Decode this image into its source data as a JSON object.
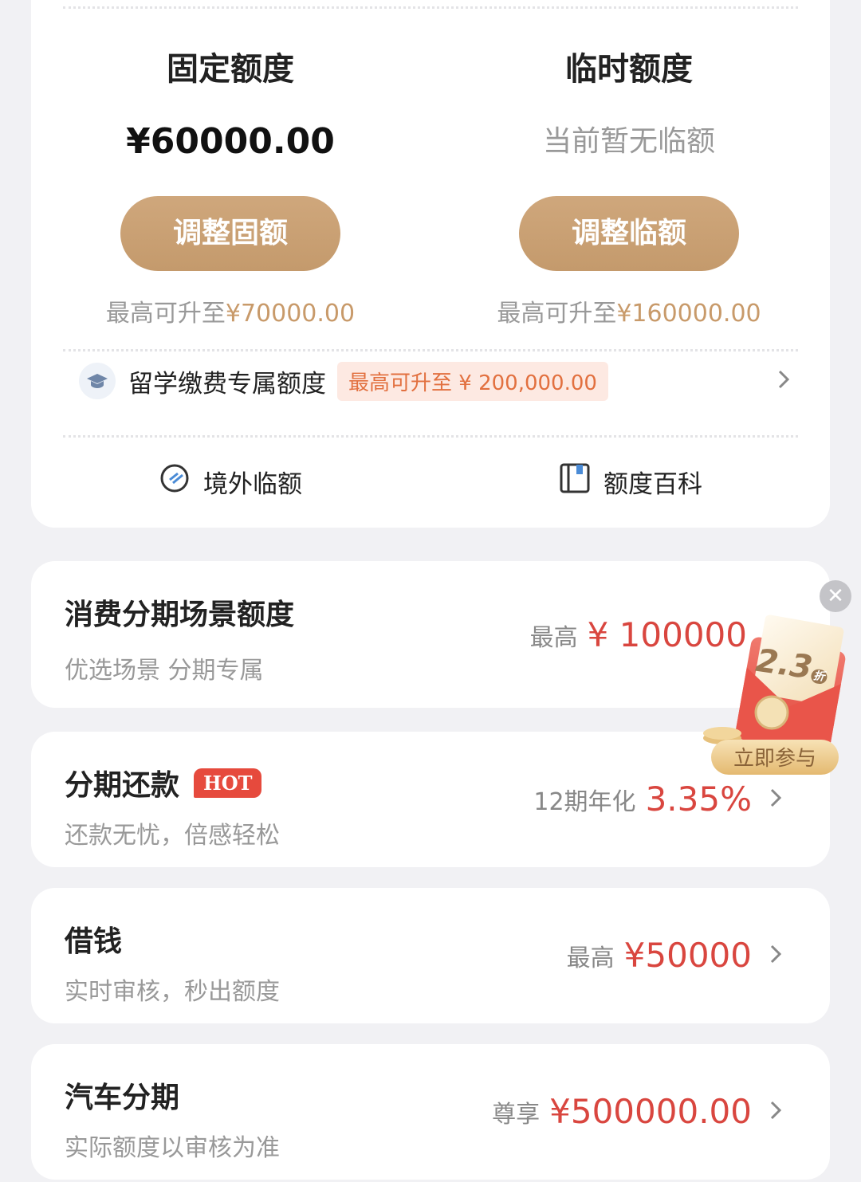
{
  "limits": {
    "fixed": {
      "title": "固定额度",
      "amount": "¥60000.00",
      "button": "调整固额",
      "note_prefix": "最高可升至",
      "note_value": "¥70000.00"
    },
    "temp": {
      "title": "临时额度",
      "status": "当前暂无临额",
      "button": "调整临额",
      "note_prefix": "最高可升至",
      "note_value": "¥160000.00"
    }
  },
  "study": {
    "label": "留学缴费专属额度",
    "tag": "最高可升至 ¥ 200,000.00"
  },
  "tools": {
    "overseas": "境外临额",
    "encyclopedia": "额度百科"
  },
  "services": [
    {
      "title": "消费分期场景额度",
      "subtitle": "优选场景 分期专属",
      "label": "最高",
      "value": "¥ 100000"
    },
    {
      "title": "分期还款",
      "badge": "HOT",
      "subtitle": "还款无忧，倍感轻松",
      "label": "12期年化",
      "value": "3.35%"
    },
    {
      "title": "借钱",
      "subtitle": "实时审核，秒出额度",
      "label": "最高",
      "value": "¥50000"
    },
    {
      "title": "汽车分期",
      "subtitle": "实际额度以审核为准",
      "label": "尊享",
      "value": "¥500000.00"
    }
  ],
  "promo": {
    "discount": "2.3",
    "discount_unit": "折",
    "cta": "立即参与"
  },
  "colors": {
    "gold": "#c89a6a",
    "red": "#d9463f",
    "hot": "#e64a3d",
    "tag_text": "#e2703f"
  }
}
